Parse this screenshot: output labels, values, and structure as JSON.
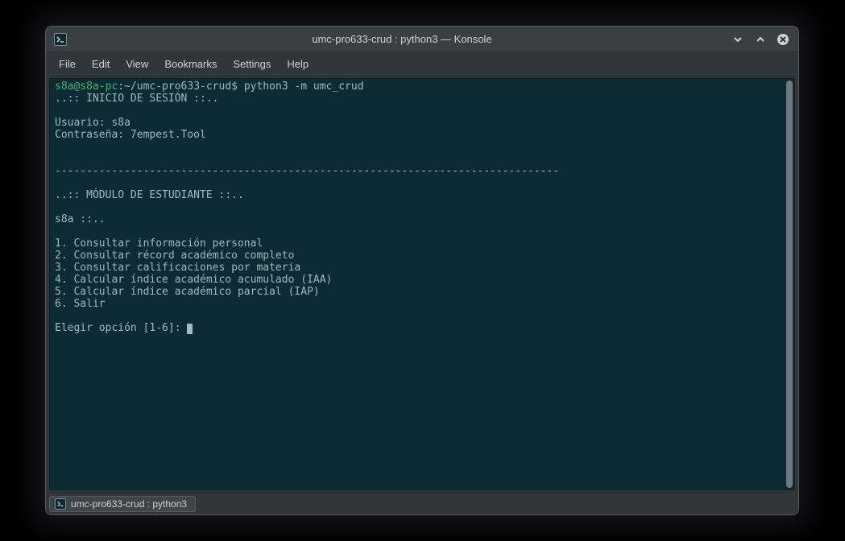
{
  "titlebar": {
    "title": "umc-pro633-crud : python3 — Konsole"
  },
  "menubar": {
    "items": [
      "File",
      "Edit",
      "View",
      "Bookmarks",
      "Settings",
      "Help"
    ]
  },
  "terminal": {
    "prompt_user": "s8a@s8a-pc",
    "prompt_sep": ":",
    "prompt_path": "~/umc-pro633-crud",
    "prompt_end": "$ ",
    "command": "python3 -m umc_crud",
    "lines": [
      "..:: INICIO DE SESIÓN ::..",
      "",
      "Usuario: s8a",
      "Contraseña: 7empest.Tool",
      "",
      "",
      "--------------------------------------------------------------------------------",
      "",
      "..:: MÓDULO DE ESTUDIANTE ::..",
      "",
      "s8a ::..",
      "",
      "1. Consultar información personal",
      "2. Consultar récord académico completo",
      "3. Consultar calificaciones por materia",
      "4. Calcular índice académico acumulado (IAA)",
      "5. Calcular índice académico parcial (IAP)",
      "6. Salir",
      "",
      "Elegir opción [1-6]: "
    ]
  },
  "tabbar": {
    "tabs": [
      {
        "label": "umc-pro633-crud : python3"
      }
    ]
  }
}
